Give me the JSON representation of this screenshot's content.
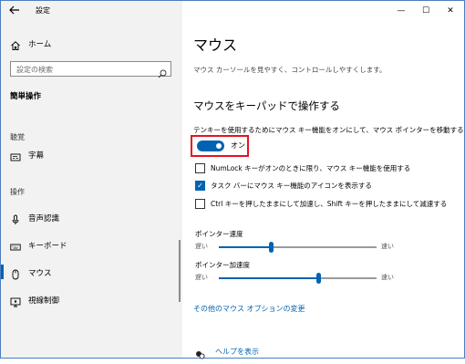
{
  "app": {
    "title": "設定"
  },
  "window_controls": {
    "minimize": "—",
    "maximize": "☐",
    "close": "✕"
  },
  "sidebar": {
    "home": "ホーム",
    "search_placeholder": "設定の検索",
    "section": "簡単操作",
    "groups": [
      {
        "label": "聴覚",
        "items": [
          {
            "label": "字幕",
            "icon": "captions-icon"
          }
        ]
      },
      {
        "label": "操作",
        "items": [
          {
            "label": "音声認識",
            "icon": "microphone-icon"
          },
          {
            "label": "キーボード",
            "icon": "keyboard-icon"
          },
          {
            "label": "マウス",
            "icon": "mouse-icon",
            "selected": true
          },
          {
            "label": "視線制御",
            "icon": "eye-control-icon"
          }
        ]
      }
    ]
  },
  "main": {
    "title": "マウス",
    "description": "マウス カーソールを見やすく、コントロールしやすくします。",
    "section_title": "マウスをキーパッドで操作する",
    "toggle": {
      "description": "テンキーを使用するためにマウス キー機能をオンにして、マウス ポインターを移動する",
      "state": "オン",
      "on": true
    },
    "checkboxes": [
      {
        "label": "NumLock キーがオンのときに限り、マウス キー機能を使用する",
        "checked": false
      },
      {
        "label": "タスク バーにマウス キー機能のアイコンを表示する",
        "checked": true
      },
      {
        "label": "Ctrl キーを押したままにして加速し、Shift キーを押したままにして減速する",
        "checked": false
      }
    ],
    "sliders": [
      {
        "label": "ポインター速度",
        "min_label": "遅い",
        "max_label": "速い",
        "value": 0.33
      },
      {
        "label": "ポインター加速度",
        "min_label": "遅い",
        "max_label": "速い",
        "value": 0.63
      }
    ],
    "link": "その他のマウス オプションの変更",
    "help": "ヘルプを表示"
  },
  "colors": {
    "accent": "#0063b1",
    "highlight_box": "#e81123",
    "sidebar_bg": "#f2f2f2"
  }
}
